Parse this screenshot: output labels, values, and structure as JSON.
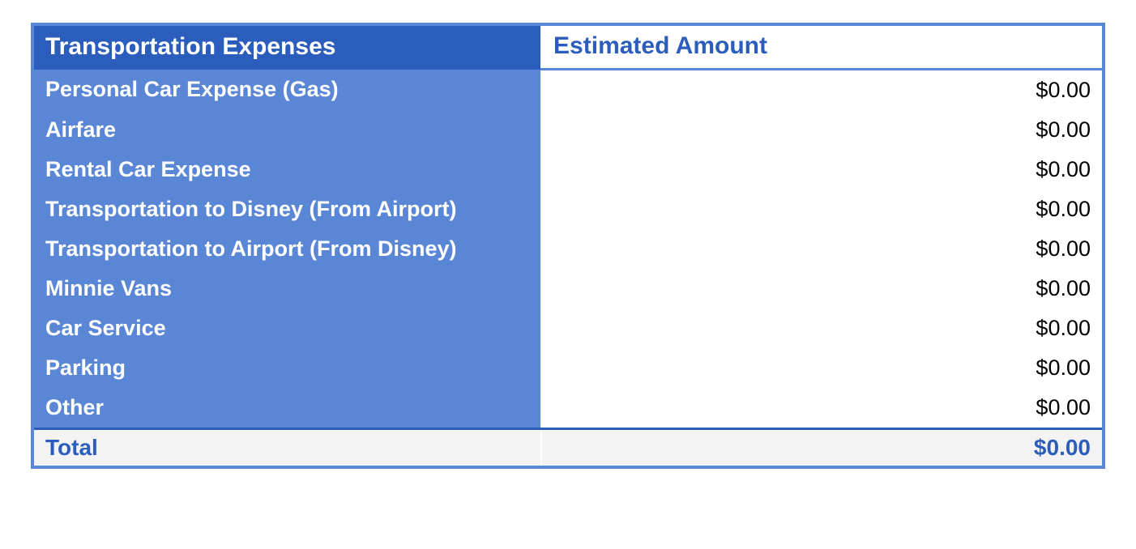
{
  "header": {
    "label": "Transportation Expenses",
    "amount": "Estimated Amount"
  },
  "rows": [
    {
      "label": "Personal Car Expense (Gas)",
      "amount": "$0.00"
    },
    {
      "label": "Airfare",
      "amount": "$0.00"
    },
    {
      "label": "Rental Car Expense",
      "amount": "$0.00"
    },
    {
      "label": "Transportation to Disney (From Airport)",
      "amount": "$0.00"
    },
    {
      "label": "Transportation to Airport (From Disney)",
      "amount": "$0.00"
    },
    {
      "label": "Minnie Vans",
      "amount": "$0.00"
    },
    {
      "label": "Car Service",
      "amount": "$0.00"
    },
    {
      "label": "Parking",
      "amount": "$0.00"
    },
    {
      "label": "Other",
      "amount": "$0.00"
    }
  ],
  "total": {
    "label": "Total",
    "amount": "$0.00"
  },
  "chart_data": {
    "type": "table",
    "title": "Transportation Expenses",
    "columns": [
      "Transportation Expenses",
      "Estimated Amount"
    ],
    "rows": [
      [
        "Personal Car Expense (Gas)",
        0.0
      ],
      [
        "Airfare",
        0.0
      ],
      [
        "Rental Car Expense",
        0.0
      ],
      [
        "Transportation to Disney (From Airport)",
        0.0
      ],
      [
        "Transportation to Airport (From Disney)",
        0.0
      ],
      [
        "Minnie Vans",
        0.0
      ],
      [
        "Car Service",
        0.0
      ],
      [
        "Parking",
        0.0
      ],
      [
        "Other",
        0.0
      ]
    ],
    "total": 0.0
  }
}
